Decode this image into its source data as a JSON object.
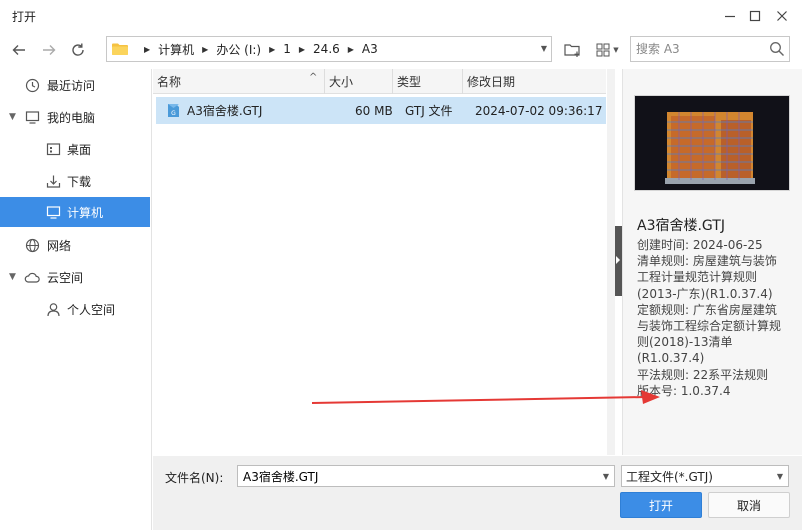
{
  "window": {
    "title": "打开"
  },
  "nav": {
    "breadcrumb": [
      "计算机",
      "办公 (I:)",
      "1",
      "24.6",
      "A3"
    ],
    "search_placeholder": "搜索 A3"
  },
  "sidebar": {
    "items": [
      {
        "label": "最近访问",
        "icon": "clock-icon"
      },
      {
        "label": "我的电脑",
        "icon": "monitor-icon"
      },
      {
        "label": "桌面",
        "icon": "desktop-icon"
      },
      {
        "label": "下载",
        "icon": "download-icon"
      },
      {
        "label": "计算机",
        "icon": "monitor-icon",
        "selected": true
      },
      {
        "label": "网络",
        "icon": "globe-icon"
      },
      {
        "label": "云空间",
        "icon": "cloud-icon"
      },
      {
        "label": "个人空间",
        "icon": "person-icon"
      }
    ]
  },
  "file_list": {
    "columns": [
      "名称",
      "大小",
      "类型",
      "修改日期"
    ],
    "rows": [
      {
        "name": "A3宿舍楼.GTJ",
        "size": "60 MB",
        "type": "GTJ 文件",
        "modified": "2024-07-02 09:36:17",
        "icon": "gtj-file-icon"
      }
    ]
  },
  "preview": {
    "file_name": "A3宿舍楼.GTJ",
    "details": [
      "创建时间: 2024-06-25",
      "清单规则: 房屋建筑与装饰工程计量规范计算规则(2013-广东)(R1.0.37.4)",
      "定额规则: 广东省房屋建筑与装饰工程综合定额计算规则(2018)-13清单(R1.0.37.4)",
      "平法规则: 22系平法规则",
      "版本号: 1.0.37.4"
    ]
  },
  "bottom": {
    "filename_label": "文件名(N):",
    "filename_value": "A3宿舍楼.GTJ",
    "filter": "工程文件(*.GTJ)",
    "open_label": "打开",
    "cancel_label": "取消"
  },
  "colors": {
    "accent": "#3c8de6",
    "selection": "#cce4f7",
    "annotation_arrow": "#e53935"
  }
}
